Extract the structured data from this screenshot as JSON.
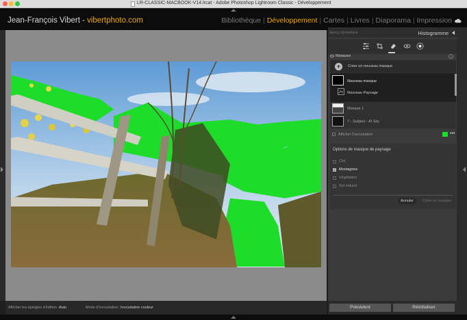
{
  "window": {
    "title": "LR-CLASSIC-MACBOOK-V14.lrcat - Adobe Photoshop Lightroom Classic - Développement"
  },
  "identity": {
    "name": "Jean-François Vibert - ",
    "site": "vibertphoto.com"
  },
  "modules": {
    "items": [
      "Bibliothèque",
      "Développement",
      "Cartes",
      "Livres",
      "Diaporama",
      "Impression"
    ],
    "active": "Développement"
  },
  "right_panel": {
    "navigator_label": "Aperçu dynamique",
    "histogram_label": "Histogramme",
    "masks_label": "Masques",
    "create_mask_label": "Créer un nouveau masque",
    "mask_items": [
      {
        "label": "Nouveau masque"
      },
      {
        "label": "Nouveau Paysage"
      },
      {
        "label": "Masque 1"
      },
      {
        "label": "7 - Subject - AI Sky"
      }
    ],
    "show_overlay_label": "Afficher l'incrustation",
    "overlay_color": "#1ddc2a",
    "more_label": "•••",
    "landscape_options": {
      "title": "Options de masque de paysage",
      "options": [
        {
          "label": "Ciel",
          "checked": false
        },
        {
          "label": "Montagnes",
          "checked": true
        },
        {
          "label": "Végétation",
          "checked": false
        },
        {
          "label": "Sol naturel",
          "checked": false
        }
      ],
      "cancel_label": "Annuler",
      "create_label": "Créer un masque"
    },
    "previous_label": "Précédent",
    "reset_label": "Réinitialiser"
  },
  "bottom_bar": {
    "edit_pins_label": "Afficher les épingles d'édition :",
    "edit_pins_value": "Auto",
    "overlay_mode_label": "Mode d'incrustation :",
    "overlay_mode_value": "Incrustation couleur"
  },
  "colors": {
    "accent": "#f2a900",
    "mask_overlay": "#1ddc2a",
    "canvas": "#8a8a8a"
  }
}
